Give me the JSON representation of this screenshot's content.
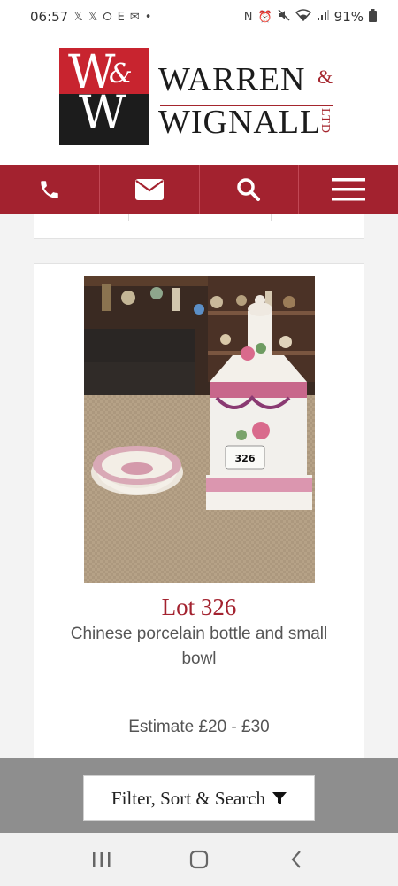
{
  "status_bar": {
    "time": "06:57",
    "left_icons": [
      "𝕏",
      "𝕏",
      "⭘",
      "E",
      "✉",
      "•"
    ],
    "right_icons": [
      "N",
      "⏰",
      "🔇",
      "wifi",
      "signal"
    ],
    "battery": "91%"
  },
  "header": {
    "logo_word1": "WARREN",
    "logo_word2": "WIGNALL",
    "logo_amp": "&",
    "logo_ltd": "LTD",
    "logo_monogram_top": "W",
    "logo_monogram_bottom": "W",
    "logo_monogram_amp": "&"
  },
  "nav": {
    "items": [
      {
        "icon": "phone-icon"
      },
      {
        "icon": "envelope-icon"
      },
      {
        "icon": "search-icon"
      },
      {
        "icon": "menu-icon"
      }
    ]
  },
  "lot": {
    "title": "Lot 326",
    "description": "Chinese porcelain bottle and small bowl",
    "estimate": "Estimate £20 - £30",
    "tag_number": "326"
  },
  "filter": {
    "label": "Filter, Sort & Search"
  },
  "colors": {
    "brand_red": "#a3222f",
    "logo_red": "#c8242f",
    "logo_black": "#1c1c1c",
    "filter_bar": "#8e8e8e"
  }
}
